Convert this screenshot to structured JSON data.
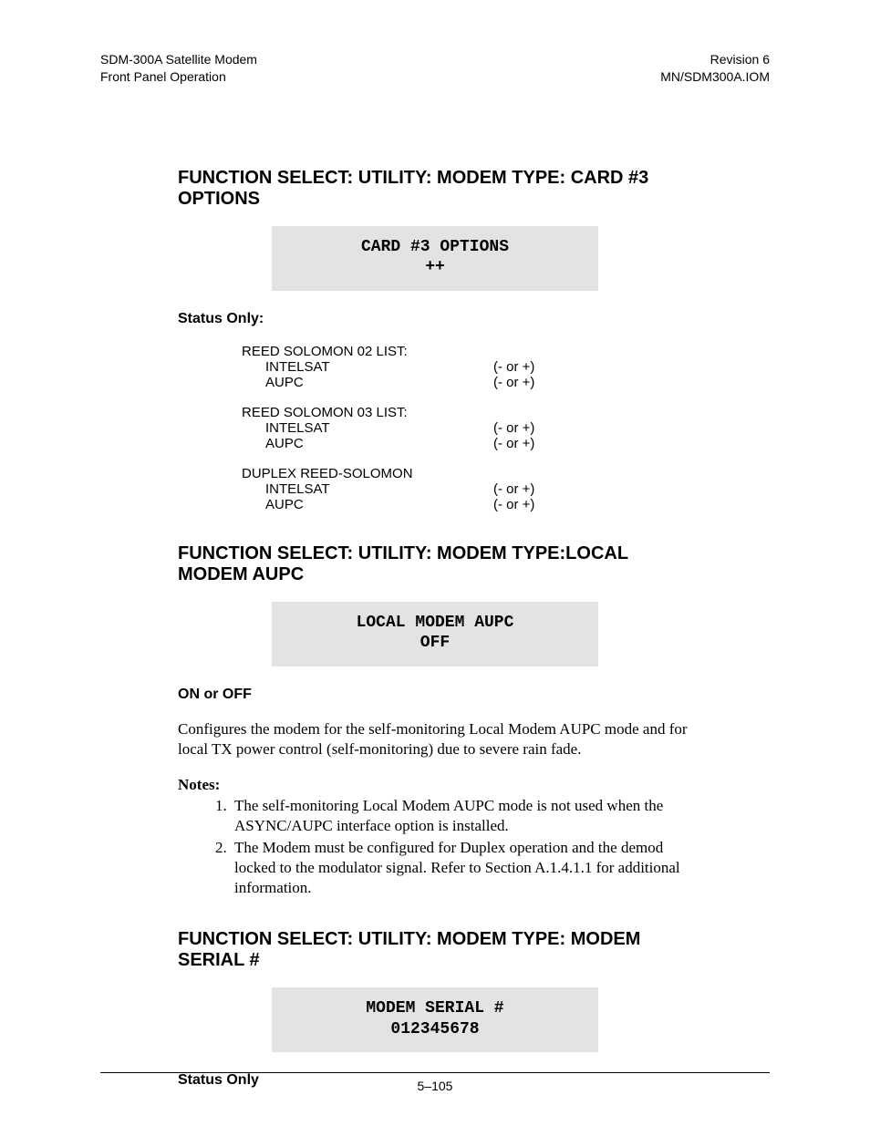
{
  "header": {
    "left_line1": "SDM-300A Satellite Modem",
    "left_line2": "Front Panel Operation",
    "right_line1": "Revision 6",
    "right_line2": "MN/SDM300A.IOM"
  },
  "section1": {
    "heading": "FUNCTION SELECT: UTILITY: MODEM TYPE: CARD #3 OPTIONS",
    "lcd_line1": "CARD #3 OPTIONS",
    "lcd_line2": "++",
    "status_label": "Status Only:",
    "groups": [
      {
        "title": "REED SOLOMON 02 LIST:",
        "rows": [
          {
            "label": "INTELSAT",
            "val": "(- or +)"
          },
          {
            "label": "AUPC",
            "val": "(- or +)"
          }
        ]
      },
      {
        "title": "REED SOLOMON 03 LIST:",
        "rows": [
          {
            "label": "INTELSAT",
            "val": "(- or +)"
          },
          {
            "label": "AUPC",
            "val": "(- or +)"
          }
        ]
      },
      {
        "title": "DUPLEX REED-SOLOMON",
        "rows": [
          {
            "label": "INTELSAT",
            "val": "(- or +)"
          },
          {
            "label": "AUPC",
            "val": "(- or +)"
          }
        ]
      }
    ]
  },
  "section2": {
    "heading": "FUNCTION SELECT: UTILITY: MODEM TYPE:LOCAL MODEM AUPC",
    "lcd_line1": "LOCAL MODEM AUPC",
    "lcd_line2": "OFF",
    "onoff_label": "ON or OFF",
    "body": "Configures the modem for the self-monitoring Local Modem AUPC mode and for local TX power control (self-monitoring) due to severe rain fade.",
    "notes_label": "Notes:",
    "notes": [
      "The self-monitoring Local Modem AUPC mode is not used when the ASYNC/AUPC interface option is installed.",
      "The Modem must be configured for Duplex operation and the demod locked to the modulator signal. Refer to Section A.1.4.1.1 for additional information."
    ]
  },
  "section3": {
    "heading": "FUNCTION SELECT: UTILITY: MODEM TYPE: MODEM SERIAL #",
    "lcd_line1": "MODEM SERIAL #",
    "lcd_line2": "012345678",
    "status_label": "Status Only"
  },
  "footer": {
    "page": "5–105"
  }
}
